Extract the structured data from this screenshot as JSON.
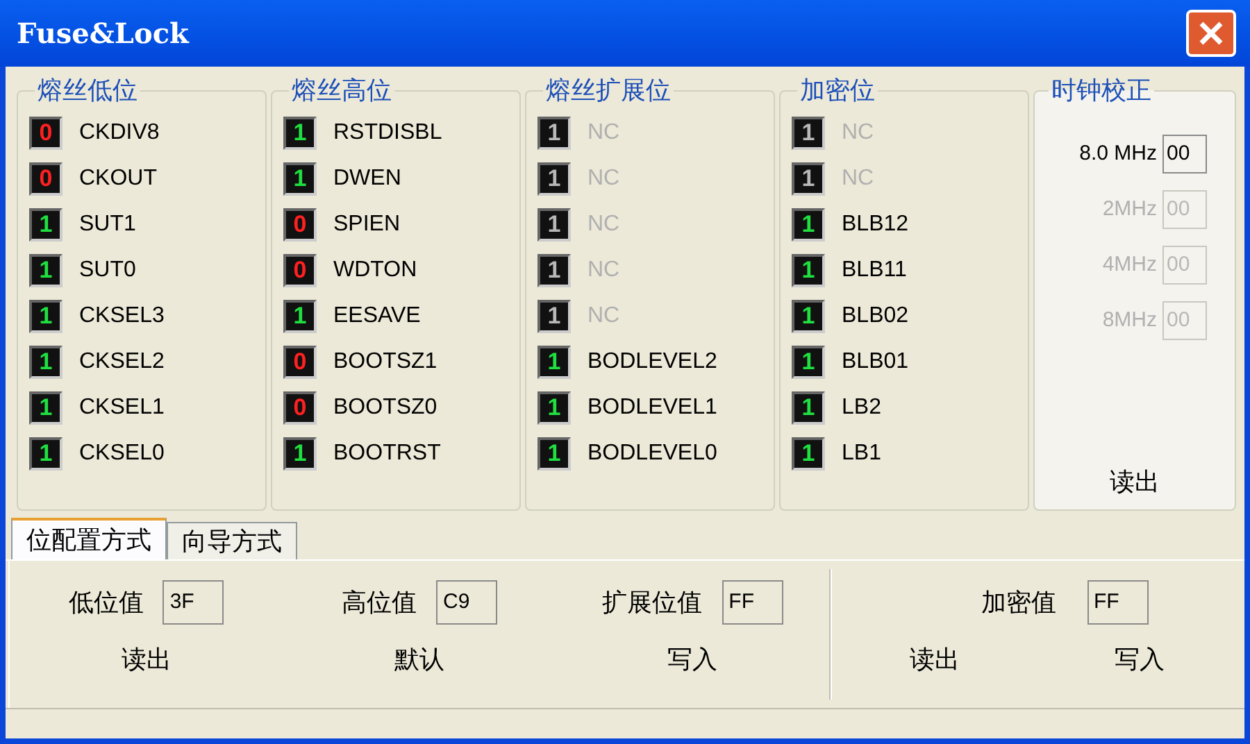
{
  "window": {
    "title": "Fuse&Lock"
  },
  "groups": [
    {
      "title": "熔丝低位",
      "bits": [
        {
          "value": "0",
          "name": "CKDIV8",
          "disabled": false
        },
        {
          "value": "0",
          "name": "CKOUT",
          "disabled": false
        },
        {
          "value": "1",
          "name": "SUT1",
          "disabled": false
        },
        {
          "value": "1",
          "name": "SUT0",
          "disabled": false
        },
        {
          "value": "1",
          "name": "CKSEL3",
          "disabled": false
        },
        {
          "value": "1",
          "name": "CKSEL2",
          "disabled": false
        },
        {
          "value": "1",
          "name": "CKSEL1",
          "disabled": false
        },
        {
          "value": "1",
          "name": "CKSEL0",
          "disabled": false
        }
      ]
    },
    {
      "title": "熔丝高位",
      "bits": [
        {
          "value": "1",
          "name": "RSTDISBL",
          "disabled": false
        },
        {
          "value": "1",
          "name": "DWEN",
          "disabled": false
        },
        {
          "value": "0",
          "name": "SPIEN",
          "disabled": false
        },
        {
          "value": "0",
          "name": "WDTON",
          "disabled": false
        },
        {
          "value": "1",
          "name": "EESAVE",
          "disabled": false
        },
        {
          "value": "0",
          "name": "BOOTSZ1",
          "disabled": false
        },
        {
          "value": "0",
          "name": "BOOTSZ0",
          "disabled": false
        },
        {
          "value": "1",
          "name": "BOOTRST",
          "disabled": false
        }
      ]
    },
    {
      "title": "熔丝扩展位",
      "bits": [
        {
          "value": "1",
          "name": "NC",
          "disabled": true
        },
        {
          "value": "1",
          "name": "NC",
          "disabled": true
        },
        {
          "value": "1",
          "name": "NC",
          "disabled": true
        },
        {
          "value": "1",
          "name": "NC",
          "disabled": true
        },
        {
          "value": "1",
          "name": "NC",
          "disabled": true
        },
        {
          "value": "1",
          "name": "BODLEVEL2",
          "disabled": false
        },
        {
          "value": "1",
          "name": "BODLEVEL1",
          "disabled": false
        },
        {
          "value": "1",
          "name": "BODLEVEL0",
          "disabled": false
        }
      ]
    },
    {
      "title": "加密位",
      "bits": [
        {
          "value": "1",
          "name": "NC",
          "disabled": true
        },
        {
          "value": "1",
          "name": "NC",
          "disabled": true
        },
        {
          "value": "1",
          "name": "BLB12",
          "disabled": false
        },
        {
          "value": "1",
          "name": "BLB11",
          "disabled": false
        },
        {
          "value": "1",
          "name": "BLB02",
          "disabled": false
        },
        {
          "value": "1",
          "name": "BLB01",
          "disabled": false
        },
        {
          "value": "1",
          "name": "LB2",
          "disabled": false
        },
        {
          "value": "1",
          "name": "LB1",
          "disabled": false
        }
      ]
    }
  ],
  "clock": {
    "title": "时钟校正",
    "rows": [
      {
        "label": "8.0 MHz",
        "value": "00",
        "disabled": false
      },
      {
        "label": "2MHz",
        "value": "00",
        "disabled": true
      },
      {
        "label": "4MHz",
        "value": "00",
        "disabled": true
      },
      {
        "label": "8MHz",
        "value": "00",
        "disabled": true
      }
    ],
    "read_button": "读出"
  },
  "tabs": [
    {
      "label": "位配置方式",
      "selected": true
    },
    {
      "label": "向导方式",
      "selected": false
    }
  ],
  "fields": [
    {
      "label": "低位值",
      "value": "3F"
    },
    {
      "label": "高位值",
      "value": "C9"
    },
    {
      "label": "扩展位值",
      "value": "FF"
    }
  ],
  "buttons": [
    "读出",
    "默认",
    "写入"
  ],
  "lock": {
    "label": "加密值",
    "value": "FF",
    "buttons": [
      "读出",
      "写入"
    ]
  }
}
